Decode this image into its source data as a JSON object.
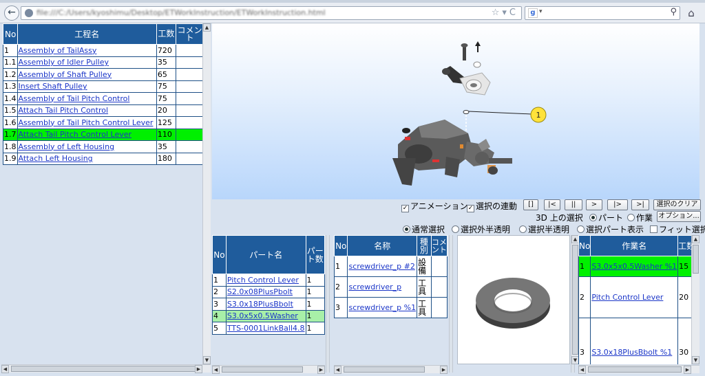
{
  "browser": {
    "url": "file:///C:/Users/kyoshimu/Desktop/ETWorkInstruction/ETWorkInstruction.html",
    "search_placeholder": "",
    "search_engine": "g"
  },
  "process_table": {
    "headers": [
      "No",
      "工程名",
      "工数",
      "コメント"
    ],
    "rows": [
      {
        "no": "1",
        "name": "Assembly of TailAssy",
        "hours": "720",
        "comment": ""
      },
      {
        "no": "1.1",
        "name": "Assembly of Idler Pulley",
        "hours": "35",
        "comment": ""
      },
      {
        "no": "1.2",
        "name": "Assembly of Shaft Pulley",
        "hours": "65",
        "comment": ""
      },
      {
        "no": "1.3",
        "name": "Insert Shaft Pulley",
        "hours": "75",
        "comment": ""
      },
      {
        "no": "1.4",
        "name": "Assembly of Tail Pitch Control",
        "hours": "75",
        "comment": ""
      },
      {
        "no": "1.5",
        "name": "Attach Tail Pitch Control",
        "hours": "20",
        "comment": ""
      },
      {
        "no": "1.6",
        "name": "Assembly of Tail Pitch Control Lever",
        "hours": "125",
        "comment": ""
      },
      {
        "no": "1.7",
        "name": "Attach Tail Pitch Control Lever",
        "hours": "110",
        "comment": "",
        "selected": true
      },
      {
        "no": "1.8",
        "name": "Assembly of Left Housing",
        "hours": "35",
        "comment": ""
      },
      {
        "no": "1.9",
        "name": "Attach Left Housing",
        "hours": "180",
        "comment": ""
      }
    ]
  },
  "view3d": {
    "callout_label": "1"
  },
  "controls": {
    "animation_label": "アニメーション",
    "linked_selection_label": "選択の連動",
    "nav_buttons": [
      "[]",
      "|<",
      "||",
      ">",
      "|>",
      ">|"
    ],
    "clear_selection": "選択のクリア",
    "selection_on_3d": "3D 上の選択",
    "radio_part": "パート",
    "radio_work": "作業",
    "options": "オプション...",
    "radio_normal": "通常選択",
    "radio_unselected_translucent": "選択外半透明",
    "radio_selected_translucent": "選択半透明",
    "radio_show_selected": "選択パート表示",
    "fit_selection": "フィット選択"
  },
  "parts_table": {
    "headers": [
      "No",
      "パート名",
      "パート数"
    ],
    "rows": [
      {
        "no": "1",
        "name": "Pitch Control Lever",
        "qty": "1"
      },
      {
        "no": "2",
        "name": "S2.0x08PlusPbolt",
        "qty": "1"
      },
      {
        "no": "3",
        "name": "S3.0x18PlusBbolt",
        "qty": "1"
      },
      {
        "no": "4",
        "name": "S3.0x5x0.5Washer",
        "qty": "1",
        "selected": true
      },
      {
        "no": "5",
        "name": "TTS-0001LinkBall4.8",
        "qty": "1"
      }
    ]
  },
  "tools_table": {
    "headers": [
      "No",
      "名称",
      "種別",
      "コメント"
    ],
    "rows": [
      {
        "no": "1",
        "name": "screwdriver_p #2",
        "type": "設備",
        "comment": ""
      },
      {
        "no": "2",
        "name": "screwdriver_p",
        "type": "工具",
        "comment": ""
      },
      {
        "no": "3",
        "name": "screwdriver_p %1",
        "type": "工具",
        "comment": ""
      }
    ]
  },
  "work_table": {
    "headers": [
      "No",
      "作業名",
      "工数"
    ],
    "rows": [
      {
        "no": "1",
        "name": "S3.0x5x0.5Washer %1",
        "hours": "15",
        "selected": true
      },
      {
        "no": "2",
        "name": "Pitch Control Lever",
        "hours": "20"
      },
      {
        "no": "3",
        "name": "S3.0x18PlusBbolt %1",
        "hours": "30"
      }
    ]
  },
  "colors": {
    "header_blue": "#1f5c9c",
    "selected_green": "#00f000",
    "selected_light_green": "#a8f0a8",
    "link_blue": "#1a35c8"
  }
}
